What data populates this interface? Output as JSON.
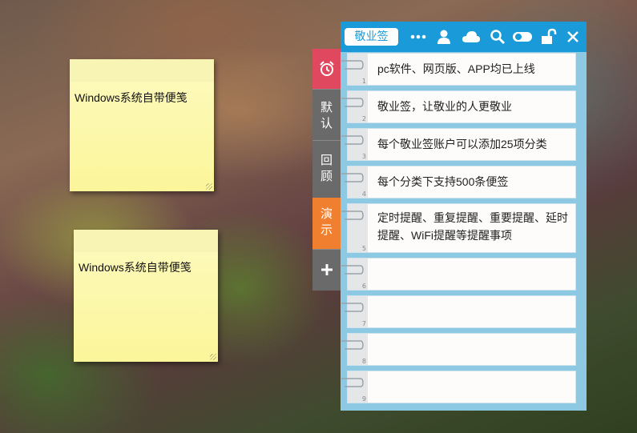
{
  "desktop_notes": [
    {
      "text": "Windows系统自带便笺"
    },
    {
      "text": "Windows系统自带便笺"
    }
  ],
  "app": {
    "brand": "敬业签",
    "header_icons": [
      "more-icon",
      "user-icon",
      "cloud-icon",
      "search-icon",
      "toggle-icon",
      "lock-icon",
      "close-icon"
    ],
    "accent": "#1a9ad9"
  },
  "tabs": [
    {
      "name": "alarm-tab",
      "label": "",
      "color": "#e04860",
      "icon": "alarm-clock-icon"
    },
    {
      "name": "tab-default",
      "label": "默\n认",
      "color": "#6a6a6a"
    },
    {
      "name": "tab-review",
      "label": "回\n顾",
      "color": "#6a6a6a"
    },
    {
      "name": "tab-demo",
      "label": "演\n示",
      "color": "#f08030"
    },
    {
      "name": "add-tab",
      "label": "+",
      "color": "#6a6a6a",
      "icon": "plus-icon"
    }
  ],
  "notes": [
    {
      "num": "1",
      "text": "pc软件、网页版、APP均已上线"
    },
    {
      "num": "2",
      "text": "敬业签，让敬业的人更敬业"
    },
    {
      "num": "3",
      "text": "每个敬业签账户可以添加25项分类"
    },
    {
      "num": "4",
      "text": "每个分类下支持500条便签"
    },
    {
      "num": "5",
      "text": "定时提醒、重复提醒、重要提醒、延时提醒、WiFi提醒等提醒事项"
    },
    {
      "num": "6",
      "text": ""
    },
    {
      "num": "7",
      "text": ""
    },
    {
      "num": "8",
      "text": ""
    },
    {
      "num": "9",
      "text": ""
    }
  ]
}
